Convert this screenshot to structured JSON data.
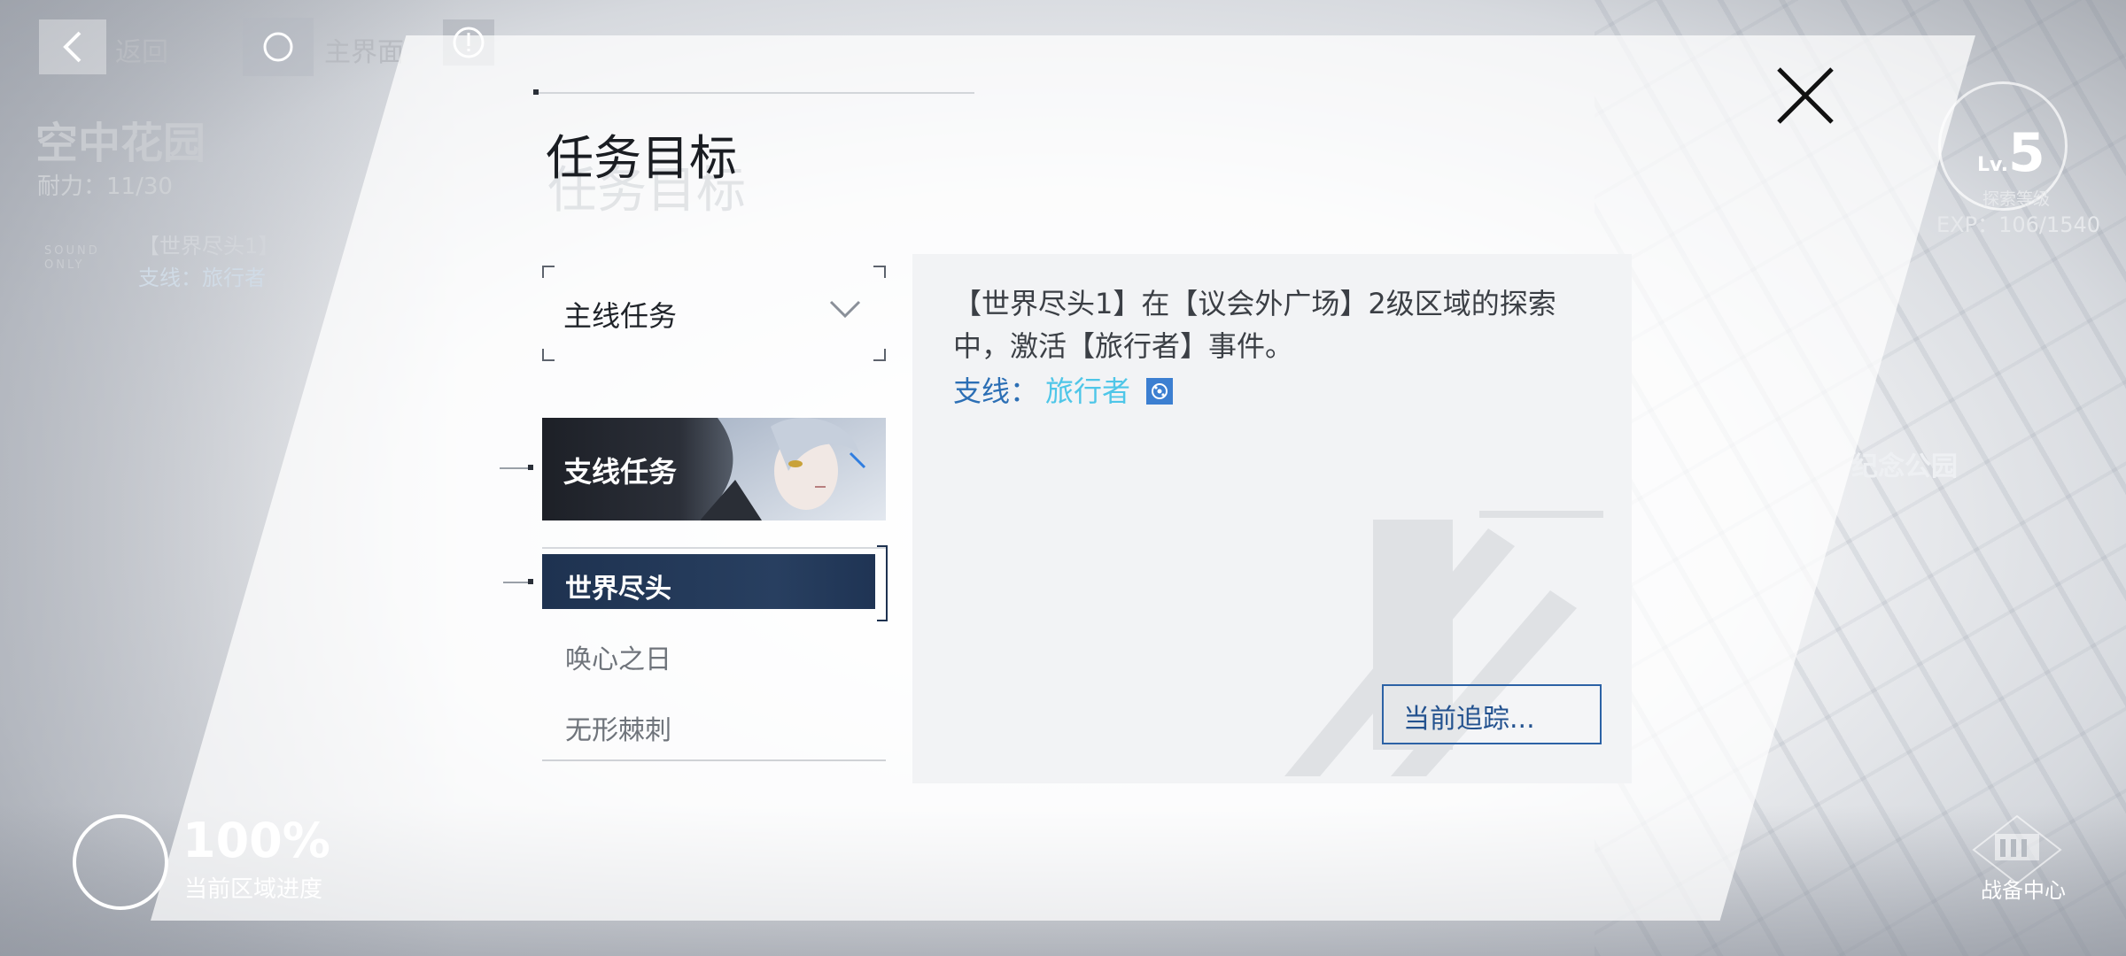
{
  "hud": {
    "back_label": "返回",
    "home_label": "主界面",
    "area_name": "空中花园",
    "stamina": "耐力：11/30",
    "sound_only": "SOUND ONLY",
    "side_note_1": "【世界尽头1】",
    "side_note_2": "支线：旅行者",
    "level_prefix": "Lv.",
    "level": "5",
    "level_label": "探索等级",
    "exp": "EXP：106/1540",
    "park_label": "纪念公园",
    "progress_pct": "100%",
    "progress_label": "当前区域进度",
    "center_label": "战备中心"
  },
  "panel": {
    "title": "任务目标",
    "dropdown_label": "主线任务",
    "banner_label": "支线任务",
    "quests": [
      {
        "label": "世界尽头",
        "active": true
      },
      {
        "label": "唤心之日",
        "active": false
      },
      {
        "label": "无形棘刺",
        "active": false
      }
    ],
    "objective": "【世界尽头1】在【议会外广场】2级区域的探索中，激活【旅行者】事件。",
    "branch_label": "支线：",
    "branch_name": "旅行者",
    "track_button": "当前追踪..."
  },
  "colors": {
    "accent_navy": "#1e3250",
    "branch_blue": "#2c6fb5",
    "branch_cyan": "#4ec6e8"
  },
  "icons": {
    "back": "chevron-left-icon",
    "home": "circle-icon",
    "alert": "exclamation-icon",
    "close": "close-icon",
    "dropdown": "chevron-down-icon",
    "branch": "branch-locate-icon",
    "center": "armory-icon"
  }
}
